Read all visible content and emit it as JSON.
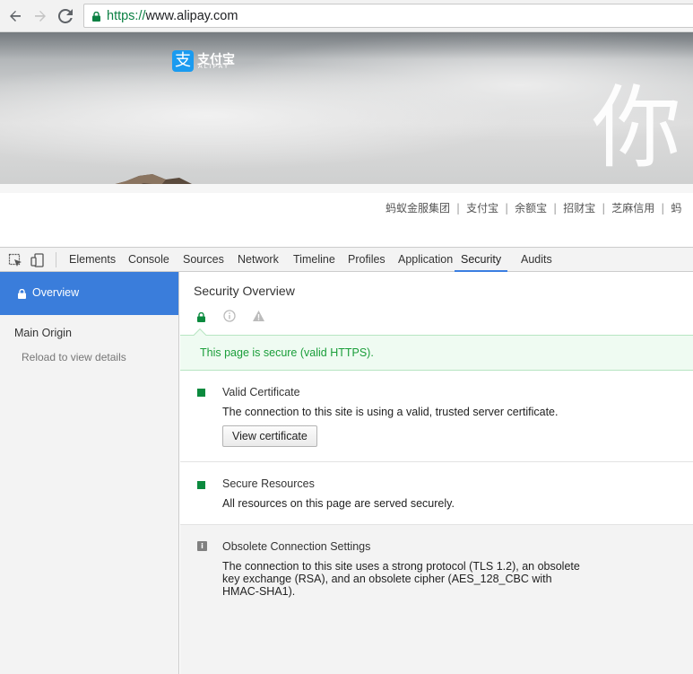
{
  "browser": {
    "url_scheme": "https://",
    "url_host": "www.alipay.com",
    "back_icon": "arrow-left-icon",
    "forward_icon": "arrow-right-icon",
    "reload_icon": "reload-icon",
    "lock_color": "#0b8043"
  },
  "page": {
    "logo_mark": "支",
    "logo_text": "支付宝",
    "logo_sub": "ALIPAY",
    "hero_char": "你",
    "links": [
      "蚂蚁金服集团",
      "支付宝",
      "余额宝",
      "招财宝",
      "芝麻信用",
      "蚂"
    ],
    "link_separator": "|"
  },
  "devtools": {
    "tabs": [
      "Elements",
      "Console",
      "Sources",
      "Network",
      "Timeline",
      "Profiles",
      "Application",
      "Security",
      "Audits"
    ],
    "active_tab": "Security",
    "accent_color": "#3b7ee1",
    "sidebar": {
      "overview_label": "Overview",
      "main_origin": "Main Origin",
      "reload_hint": "Reload to view details"
    },
    "main": {
      "title": "Security Overview",
      "secure_message": "This page is secure (valid HTTPS).",
      "secure_color": "#1a9e3a",
      "sections": [
        {
          "title": "Valid Certificate",
          "description": "The connection to this site is using a valid, trusted server certificate.",
          "button": "View certificate",
          "status": "secure"
        },
        {
          "title": "Secure Resources",
          "description": "All resources on this page are served securely.",
          "status": "secure"
        },
        {
          "title": "Obsolete Connection Settings",
          "description": "The connection to this site uses a strong protocol (TLS 1.2), an obsolete key exchange (RSA), and an obsolete cipher (AES_128_CBC with HMAC-SHA1).",
          "status": "info",
          "info_mark": "i"
        }
      ]
    }
  }
}
